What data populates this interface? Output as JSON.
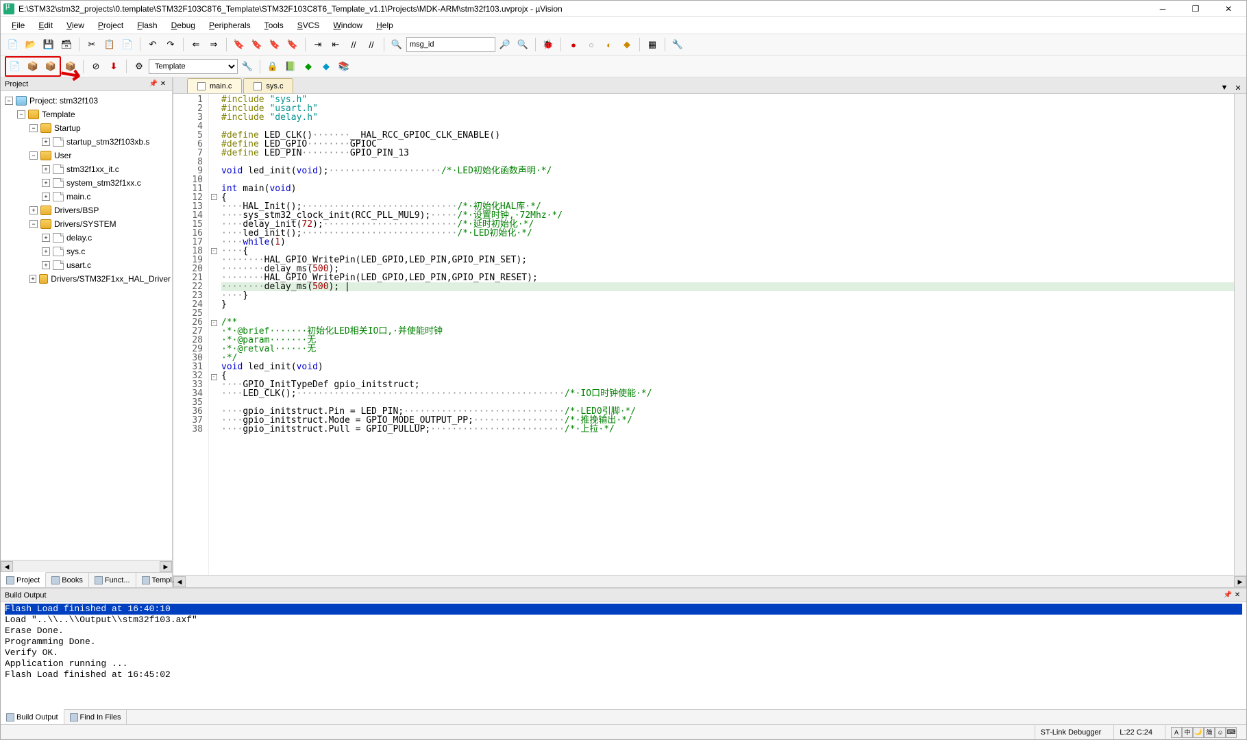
{
  "title": "E:\\STM32\\stm32_projects\\0.template\\STM32F103C8T6_Template\\STM32F103C8T6_Template_v1.1\\Projects\\MDK-ARM\\stm32f103.uvprojx - µVision",
  "menu": [
    "File",
    "Edit",
    "View",
    "Project",
    "Flash",
    "Debug",
    "Peripherals",
    "Tools",
    "SVCS",
    "Window",
    "Help"
  ],
  "search_combo": "msg_id",
  "target_combo": "Template",
  "project_panel": {
    "title": "Project"
  },
  "tree": {
    "root": "Project: stm32f103",
    "target": "Template",
    "groups": [
      {
        "name": "Startup",
        "files": [
          "startup_stm32f103xb.s"
        ]
      },
      {
        "name": "User",
        "files": [
          "stm32f1xx_it.c",
          "system_stm32f1xx.c",
          "main.c"
        ]
      },
      {
        "name": "Drivers/BSP",
        "files": []
      },
      {
        "name": "Drivers/SYSTEM",
        "files": [
          "delay.c",
          "sys.c",
          "usart.c"
        ]
      },
      {
        "name": "Drivers/STM32F1xx_HAL_Driver",
        "files": []
      }
    ]
  },
  "sidebar_tabs": [
    "Project",
    "Books",
    "Funct...",
    "Templ..."
  ],
  "editor_tabs": [
    {
      "name": "main.c",
      "active": true
    },
    {
      "name": "sys.c",
      "active": false
    }
  ],
  "code": [
    {
      "n": 1,
      "t": "<span class='pp'>#include</span> <span class='str'>\"sys.h\"</span>"
    },
    {
      "n": 2,
      "t": "<span class='pp'>#include</span> <span class='str'>\"usart.h\"</span>"
    },
    {
      "n": 3,
      "t": "<span class='pp'>#include</span> <span class='str'>\"delay.h\"</span>"
    },
    {
      "n": 4,
      "t": ""
    },
    {
      "n": 5,
      "t": "<span class='pp'>#define</span> LED_CLK()<span class='dim'>·······</span>__HAL_RCC_GPIOC_CLK_ENABLE()"
    },
    {
      "n": 6,
      "t": "<span class='pp'>#define</span> LED_GPIO<span class='dim'>········</span>GPIOC"
    },
    {
      "n": 7,
      "t": "<span class='pp'>#define</span> LED_PIN<span class='dim'>·········</span>GPIO_PIN_13"
    },
    {
      "n": 8,
      "t": ""
    },
    {
      "n": 9,
      "t": "<span class='kw'>void</span> led_init(<span class='kw'>void</span>);<span class='dim'>·····················</span><span class='cm'>/*·LED初始化函数声明·*/</span>"
    },
    {
      "n": 10,
      "t": ""
    },
    {
      "n": 11,
      "t": "<span class='kw'>int</span> main(<span class='kw'>void</span>)"
    },
    {
      "n": 12,
      "t": "{",
      "fold": "-"
    },
    {
      "n": 13,
      "t": "<span class='dim'>····</span>HAL_Init();<span class='dim'>·····························</span><span class='cm'>/*·初始化HAL库·*/</span>"
    },
    {
      "n": 14,
      "t": "<span class='dim'>····</span>sys_stm32_clock_init(RCC_PLL_MUL9);<span class='dim'>·····</span><span class='cm'>/*·设置时钟,·72Mhz·*/</span>"
    },
    {
      "n": 15,
      "t": "<span class='dim'>····</span>delay_init(<span class='num'>72</span>);<span class='dim'>·························</span><span class='cm'>/*·延时初始化·*/</span>"
    },
    {
      "n": 16,
      "t": "<span class='dim'>····</span>led_init();<span class='dim'>·····························</span><span class='cm'>/*·LED初始化·*/</span>"
    },
    {
      "n": 17,
      "t": "<span class='dim'>····</span><span class='kw'>while</span>(<span class='num'>1</span>)"
    },
    {
      "n": 18,
      "t": "<span class='dim'>····</span>{",
      "fold": "-"
    },
    {
      "n": 19,
      "t": "<span class='dim'>········</span>HAL_GPIO_WritePin(LED_GPIO,LED_PIN,GPIO_PIN_SET);"
    },
    {
      "n": 20,
      "t": "<span class='dim'>········</span>delay_ms(<span class='num'>500</span>);"
    },
    {
      "n": 21,
      "t": "<span class='dim'>········</span>HAL_GPIO_WritePin(LED_GPIO,LED_PIN,GPIO_PIN_RESET);"
    },
    {
      "n": 22,
      "t": "<span class='dim'>········</span>delay_ms(<span class='num'>500</span>); |",
      "hl": true
    },
    {
      "n": 23,
      "t": "<span class='dim'>····</span>}"
    },
    {
      "n": 24,
      "t": "}"
    },
    {
      "n": 25,
      "t": ""
    },
    {
      "n": 26,
      "t": "<span class='cm'>/**</span>",
      "fold": "-"
    },
    {
      "n": 27,
      "t": "<span class='cm'>·*·@brief·······初始化LED相关IO口,·并使能时钟</span>"
    },
    {
      "n": 28,
      "t": "<span class='cm'>·*·@param·······无</span>"
    },
    {
      "n": 29,
      "t": "<span class='cm'>·*·@retval······无</span>"
    },
    {
      "n": 30,
      "t": "<span class='cm'>·*/</span>"
    },
    {
      "n": 31,
      "t": "<span class='kw'>void</span> led_init(<span class='kw'>void</span>)"
    },
    {
      "n": 32,
      "t": "{",
      "fold": "-"
    },
    {
      "n": 33,
      "t": "<span class='dim'>····</span>GPIO_InitTypeDef gpio_initstruct;"
    },
    {
      "n": 34,
      "t": "<span class='dim'>····</span>LED_CLK();<span class='dim'>··················································</span><span class='cm'>/*·IO口时钟使能·*/</span>"
    },
    {
      "n": 35,
      "t": ""
    },
    {
      "n": 36,
      "t": "<span class='dim'>····</span>gpio_initstruct.Pin = LED_PIN;<span class='dim'>······························</span><span class='cm'>/*·LED0引脚·*/</span>"
    },
    {
      "n": 37,
      "t": "<span class='dim'>····</span>gpio_initstruct.Mode = GPIO_MODE_OUTPUT_PP;<span class='dim'>·················</span><span class='cm'>/*·推挽输出·*/</span>"
    },
    {
      "n": 38,
      "t": "<span class='dim'>····</span>gpio_initstruct.Pull = GPIO_PULLUP;<span class='dim'>·························</span><span class='cm'>/*·上拉·*/</span>"
    }
  ],
  "output": {
    "title": "Build Output",
    "lines": [
      {
        "t": "Flash Load finished at 16:40:10",
        "hl": true
      },
      {
        "t": "Load \"..\\\\..\\\\Output\\\\stm32f103.axf\""
      },
      {
        "t": "Erase Done."
      },
      {
        "t": "Programming Done."
      },
      {
        "t": "Verify OK."
      },
      {
        "t": "Application running ..."
      },
      {
        "t": "Flash Load finished at 16:45:02"
      }
    ]
  },
  "output_tabs": [
    "Build Output",
    "Find In Files"
  ],
  "status": {
    "debugger": "ST-Link Debugger",
    "pos": "L:22 C:24"
  }
}
